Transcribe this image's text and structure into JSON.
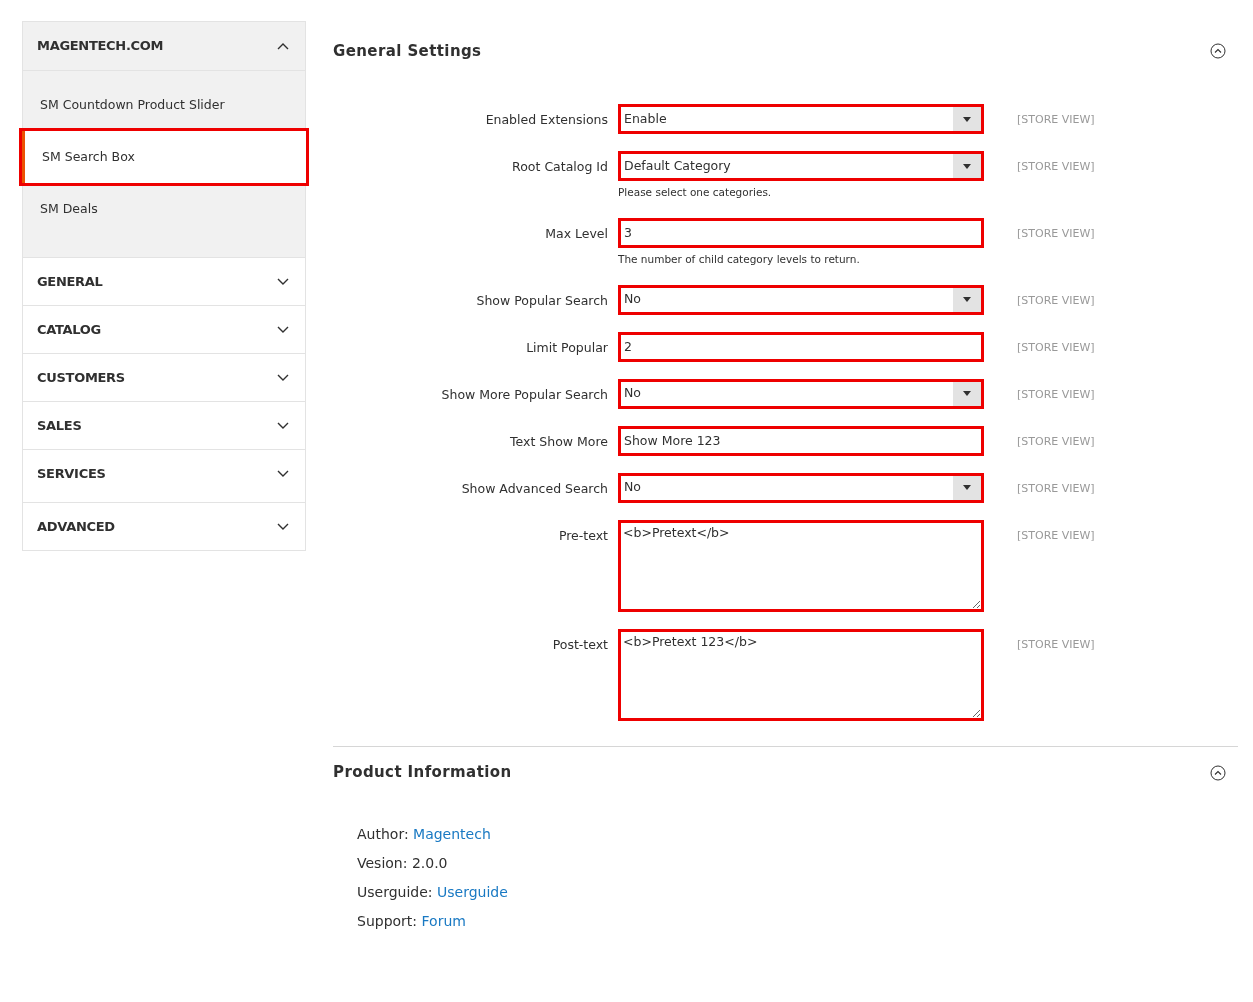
{
  "sidebar": [
    {
      "title": "MAGENTECH.COM",
      "expanded": true,
      "items": [
        {
          "label": "SM Countdown Product Slider",
          "selected": false,
          "highlighted": false
        },
        {
          "label": "SM Search Box",
          "selected": true,
          "highlighted": true
        },
        {
          "label": "SM Deals",
          "selected": false,
          "highlighted": false
        }
      ]
    },
    {
      "title": "GENERAL",
      "expanded": false
    },
    {
      "title": "CATALOG",
      "expanded": false
    },
    {
      "title": "CUSTOMERS",
      "expanded": false
    },
    {
      "title": "SALES",
      "expanded": false
    },
    {
      "title": "SERVICES",
      "expanded": false
    },
    {
      "title": "ADVANCED",
      "expanded": false
    }
  ],
  "general_settings": {
    "title": "General Settings",
    "expanded": true,
    "fields": [
      {
        "label": "Enabled Extensions",
        "kind": "select",
        "value": "Enable",
        "scope": "[STORE VIEW]",
        "highlighted": true
      },
      {
        "label": "Root Catalog Id",
        "kind": "select",
        "value": "Default Category",
        "note": "Please select one categories.",
        "scope": "[STORE VIEW]",
        "highlighted": true
      },
      {
        "label": "Max Level",
        "kind": "text",
        "value": "3",
        "note": "The number of child category levels to return.",
        "scope": "[STORE VIEW]",
        "highlighted": true
      },
      {
        "label": "Show Popular Search",
        "kind": "select",
        "value": "No",
        "scope": "[STORE VIEW]",
        "highlighted": true
      },
      {
        "label": "Limit Popular",
        "kind": "text",
        "value": "2",
        "scope": "[STORE VIEW]",
        "highlighted": true
      },
      {
        "label": "Show More Popular Search",
        "kind": "select",
        "value": "No",
        "scope": "[STORE VIEW]",
        "highlighted": true
      },
      {
        "label": "Text Show More",
        "kind": "text",
        "value": "Show More 123",
        "scope": "[STORE VIEW]",
        "highlighted": true
      },
      {
        "label": "Show Advanced Search",
        "kind": "select",
        "value": "No",
        "scope": "[STORE VIEW]",
        "highlighted": true
      },
      {
        "label": "Pre-text",
        "kind": "textarea",
        "value": "<b>Pretext</b>",
        "scope": "[STORE VIEW]",
        "highlighted": true
      },
      {
        "label": "Post-text",
        "kind": "textarea",
        "value": "<b>Pretext 123</b>",
        "scope": "[STORE VIEW]",
        "highlighted": true
      }
    ]
  },
  "product_information": {
    "title": "Product Information",
    "expanded": true,
    "lines": [
      {
        "label": "Author:",
        "value": "Magentech",
        "link": true
      },
      {
        "label": "Vesion:",
        "value": "2.0.0",
        "link": false
      },
      {
        "label": "Userguide:",
        "value": "Userguide",
        "link": true
      },
      {
        "label": "Support:",
        "value": "Forum",
        "link": true
      }
    ]
  }
}
